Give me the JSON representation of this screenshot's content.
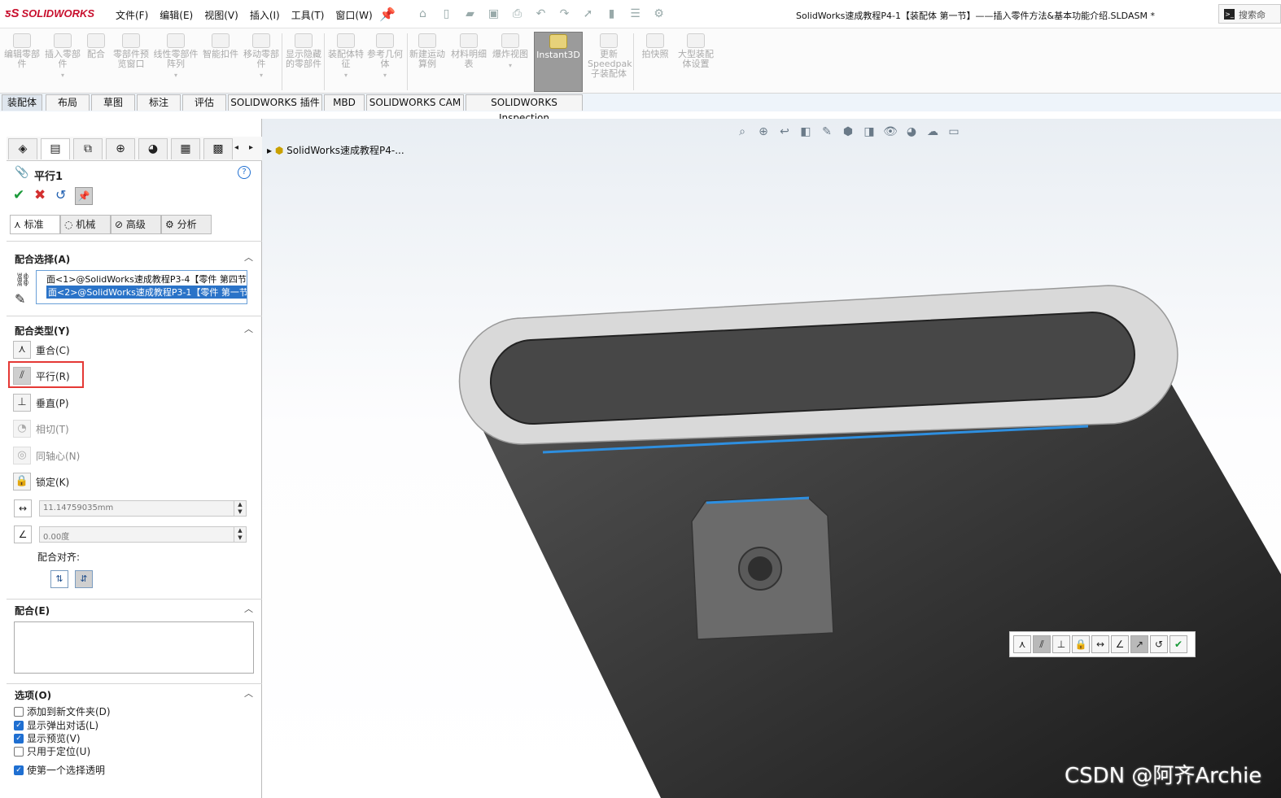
{
  "app": {
    "logo": "SOLIDWORKS",
    "window_title": "SolidWorks速成教程P4-1【装配体  第一节】——插入零件方法&基本功能介绍.SLDASM *",
    "search_placeholder": "搜索命"
  },
  "menu": [
    "文件(F)",
    "编辑(E)",
    "视图(V)",
    "插入(I)",
    "工具(T)",
    "窗口(W)"
  ],
  "ribbon": [
    {
      "label": "编辑零部件"
    },
    {
      "label": "插入零部件"
    },
    {
      "label": "配合"
    },
    {
      "label": "零部件预览窗口"
    },
    {
      "label": "线性零部件阵列"
    },
    {
      "label": "智能扣件"
    },
    {
      "label": "移动零部件"
    },
    {
      "label": "显示隐藏的零部件"
    },
    {
      "label": "装配体特征"
    },
    {
      "label": "参考几何体"
    },
    {
      "label": "新建运动算例"
    },
    {
      "label": "材料明细表"
    },
    {
      "label": "爆炸视图"
    },
    {
      "label": "Instant3D"
    },
    {
      "label": "更新Speedpak子装配体"
    },
    {
      "label": "拍快照"
    },
    {
      "label": "大型装配体设置"
    }
  ],
  "command_tabs": [
    "装配体",
    "布局",
    "草图",
    "标注",
    "评估",
    "SOLIDWORKS 插件",
    "MBD",
    "SOLIDWORKS CAM",
    "SOLIDWORKS Inspection"
  ],
  "property_manager": {
    "title": "平行1",
    "subtabs": [
      "标准",
      "机械",
      "高级",
      "分析"
    ],
    "mate_selection_title": "配合选择(A)",
    "selections": [
      "面<1>@SolidWorks速成教程P3-4【零件  第四节】",
      "面<2>@SolidWorks速成教程P3-1【零件  第一节】"
    ],
    "mate_type_title": "配合类型(Y)",
    "mate_types": [
      {
        "label": "重合(C)",
        "icon": "coincident-icon"
      },
      {
        "label": "平行(R)",
        "icon": "parallel-icon"
      },
      {
        "label": "垂直(P)",
        "icon": "perpendicular-icon"
      },
      {
        "label": "相切(T)",
        "icon": "tangent-icon"
      },
      {
        "label": "同轴心(N)",
        "icon": "concentric-icon"
      },
      {
        "label": "锁定(K)",
        "icon": "lock-icon"
      }
    ],
    "distance_value": "11.14759035mm",
    "angle_value": "0.00度",
    "alignment_label": "配合对齐:",
    "mates_title": "配合(E)",
    "options_title": "选项(O)",
    "options": [
      {
        "label": "添加到新文件夹(D)",
        "checked": false
      },
      {
        "label": "显示弹出对话(L)",
        "checked": true
      },
      {
        "label": "显示预览(V)",
        "checked": true
      },
      {
        "label": "只用于定位(U)",
        "checked": false
      },
      {
        "label": "使第一个选择透明",
        "checked": true
      }
    ]
  },
  "viewport": {
    "tree_root": "SolidWorks速成教程P4-...",
    "watermark": "CSDN @阿齐Archie"
  }
}
